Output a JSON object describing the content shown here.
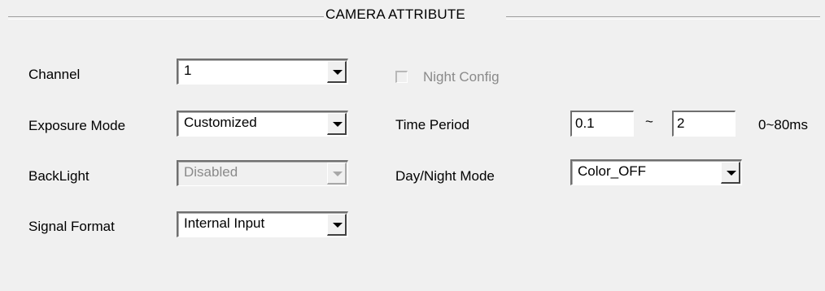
{
  "group": {
    "title": "CAMERA ATTRIBUTE"
  },
  "left": {
    "channel": {
      "label": "Channel",
      "value": "1"
    },
    "exposure_mode": {
      "label": "Exposure Mode",
      "value": "Customized"
    },
    "backlight": {
      "label": "BackLight",
      "value": "Disabled",
      "disabled": true
    },
    "signal_format": {
      "label": "Signal Format",
      "value": "Internal Input"
    }
  },
  "right": {
    "night_config": {
      "label": "Night Config",
      "checked": false,
      "disabled": true
    },
    "time_period": {
      "label": "Time Period",
      "from": "0.1",
      "separator": "~",
      "to": "2",
      "range_hint": "0~80ms"
    },
    "day_night_mode": {
      "label": "Day/Night Mode",
      "value": "Color_OFF"
    }
  },
  "icons": {
    "dropdown_arrow": "chevron-down-icon"
  }
}
